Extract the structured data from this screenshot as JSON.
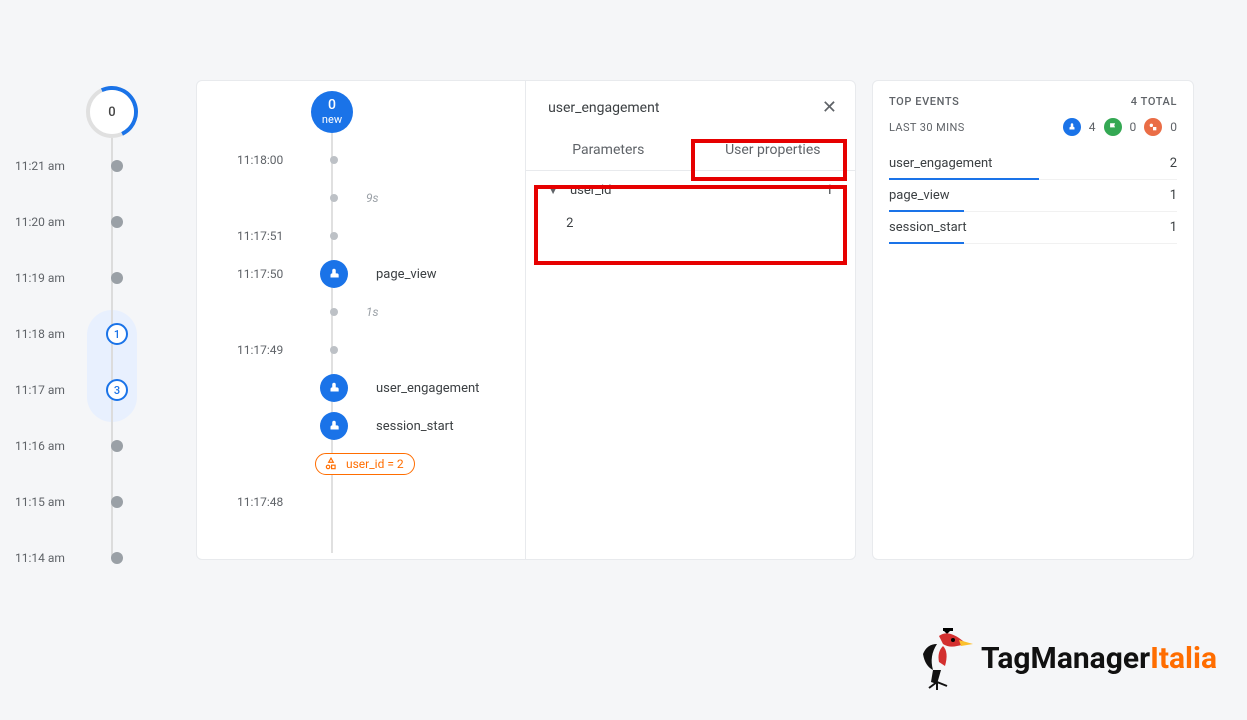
{
  "left_timeline": {
    "top_node": "0",
    "rows": [
      {
        "time": "11:21 am",
        "type": "dot"
      },
      {
        "time": "11:20 am",
        "type": "dot"
      },
      {
        "time": "11:19 am",
        "type": "dot"
      },
      {
        "time": "11:18 am",
        "type": "ring",
        "count": "1"
      },
      {
        "time": "11:17 am",
        "type": "ring",
        "count": "3"
      },
      {
        "time": "11:16 am",
        "type": "dot"
      },
      {
        "time": "11:15 am",
        "type": "dot"
      },
      {
        "time": "11:14 am",
        "type": "dot"
      }
    ]
  },
  "mid": {
    "new_count": "0",
    "new_label": "new",
    "rows": [
      {
        "time": "11:18:00",
        "type": "dot"
      },
      {
        "gap": "9s"
      },
      {
        "time": "11:17:51",
        "type": "dot"
      },
      {
        "time": "11:17:50",
        "type": "event",
        "label": "page_view"
      },
      {
        "gap": "1s"
      },
      {
        "time": "11:17:49",
        "type": "dot"
      },
      {
        "type": "event",
        "label": "user_engagement"
      },
      {
        "type": "event",
        "label": "session_start"
      },
      {
        "type": "chip",
        "label": "user_id = 2"
      },
      {
        "time": "11:17:48"
      }
    ],
    "detail": {
      "title": "user_engagement",
      "tabs": [
        "Parameters",
        "User properties"
      ],
      "prop_name": "user_id",
      "prop_count": "1",
      "prop_value": "2"
    }
  },
  "right": {
    "title": "TOP EVENTS",
    "total": "4 TOTAL",
    "subtitle": "LAST 30 MINS",
    "badges": {
      "blue": "4",
      "green": "0",
      "orange": "0"
    },
    "events": [
      {
        "name": "user_engagement",
        "count": "2",
        "bar": 52
      },
      {
        "name": "page_view",
        "count": "1",
        "bar": 26
      },
      {
        "name": "session_start",
        "count": "1",
        "bar": 26
      }
    ]
  },
  "logo": {
    "brand": "TagManager",
    "suffix": "Italia"
  }
}
